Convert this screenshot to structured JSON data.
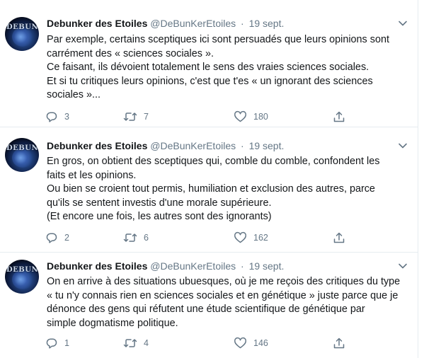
{
  "tweets": [
    {
      "author_name": "Debunker des Etoiles",
      "author_handle": "@DeBunKerEtoiles",
      "separator": "·",
      "date": "19 sept.",
      "avatar_text": "DEBUNK",
      "lines": [
        "Par exemple, certains sceptiques ici sont persuadés que leurs opinions sont",
        "carrément des « sciences sociales ».",
        "Ce faisant, ils dévoient totalement le sens des vraies sciences sociales.",
        "Et si tu critiques leurs opinions, c'est que t'es « un ignorant des sciences",
        "sociales »..."
      ],
      "replies": "3",
      "retweets": "7",
      "likes": "180"
    },
    {
      "author_name": "Debunker des Etoiles",
      "author_handle": "@DeBunKerEtoiles",
      "separator": "·",
      "date": "19 sept.",
      "avatar_text": "DEBUNK",
      "lines": [
        "En gros, on obtient des sceptiques qui, comble du comble, confondent les",
        "faits et les opinions.",
        "Ou bien se croient tout permis, humiliation et exclusion des autres, parce",
        "qu'ils se sentent investis d'une morale supérieure.",
        "(Et encore une fois, les autres sont des ignorants)"
      ],
      "replies": "2",
      "retweets": "6",
      "likes": "162"
    },
    {
      "author_name": "Debunker des Etoiles",
      "author_handle": "@DeBunKerEtoiles",
      "separator": "·",
      "date": "19 sept.",
      "avatar_text": "DEBUNK",
      "lines": [
        "On en arrive à des situations ubuesques, où je me reçois des critiques du type",
        "« tu n'y connais rien en sciences sociales et en génétique » juste parce que je",
        "dénonce des gens qui réfutent une étude scientifique de génétique par",
        "simple dogmatisme politique."
      ],
      "replies": "1",
      "retweets": "4",
      "likes": "146"
    }
  ],
  "icons": {
    "reply": "reply-icon",
    "retweet": "retweet-icon",
    "like": "heart-icon",
    "share": "share-icon",
    "more": "chevron-down-icon"
  },
  "colors": {
    "text": "#14171a",
    "secondary": "#657786",
    "divider": "#e6ecf0"
  }
}
